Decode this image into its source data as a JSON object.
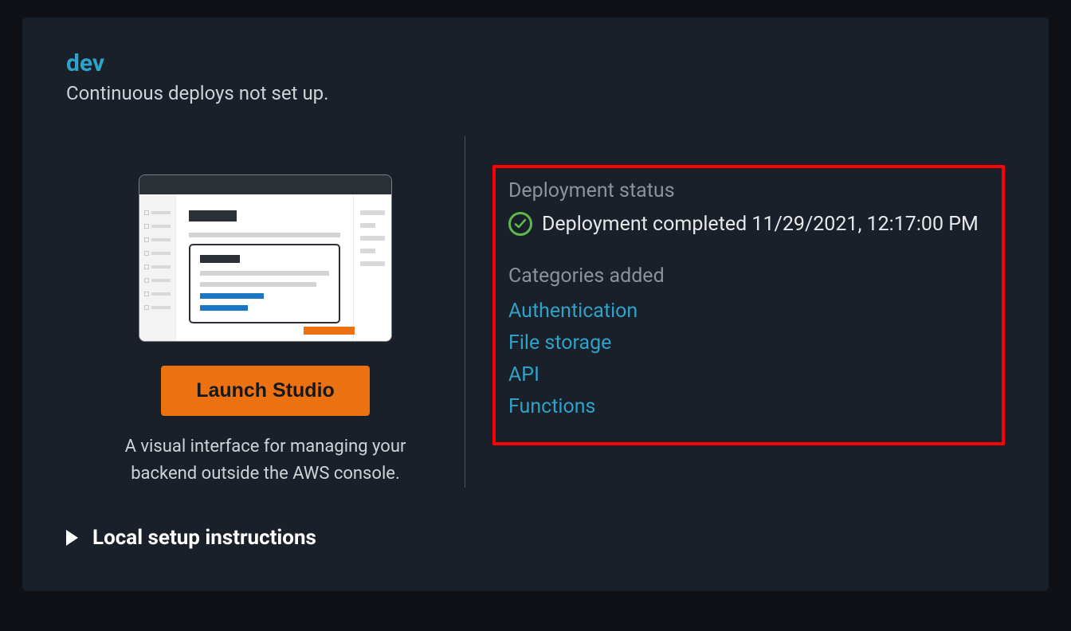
{
  "env": {
    "name": "dev",
    "subtitle": "Continuous deploys not set up."
  },
  "studio": {
    "launch_label": "Launch Studio",
    "description_line1": "A visual interface for managing your",
    "description_line2": "backend outside the AWS console."
  },
  "deployment": {
    "status_label": "Deployment status",
    "status_text": "Deployment completed 11/29/2021, 12:17:00 PM",
    "categories_label": "Categories added",
    "categories": [
      {
        "name": "Authentication"
      },
      {
        "name": "File storage"
      },
      {
        "name": "API"
      },
      {
        "name": "Functions"
      }
    ]
  },
  "local_setup": {
    "label": "Local setup instructions"
  }
}
